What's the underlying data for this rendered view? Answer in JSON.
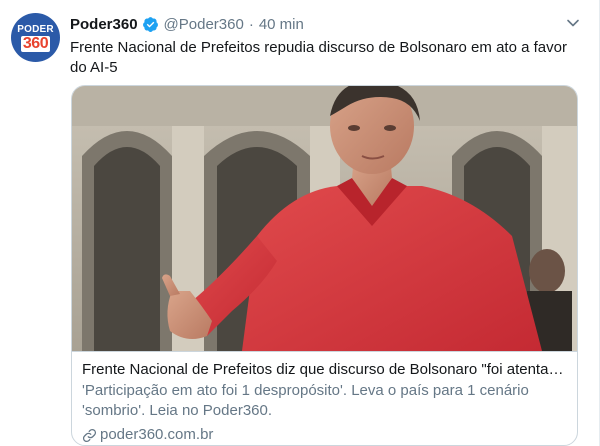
{
  "author": {
    "display_name": "Poder360",
    "handle": "@Poder360",
    "separator": "·",
    "time": "40 min",
    "avatar_icon": "poder360-logo",
    "avatar_text_top": "PODER",
    "avatar_text_bottom": "360",
    "verified_icon": "verified-badge-icon",
    "verified_color": "#1da1f2"
  },
  "tweet": {
    "text": "Frente Nacional de Prefeitos repudia discurso de Bolsonaro em ato a favor do AI-5"
  },
  "card": {
    "title": "Frente Nacional de Prefeitos diz que discurso de Bolsonaro \"foi atentad...",
    "description": "'Participação em ato foi 1 despropósito'. Leva o país para 1 cenário 'sombrio'. Leia no Poder360.",
    "domain": "poder360.com.br",
    "link_icon": "link-icon"
  },
  "colors": {
    "text_primary": "#14171a",
    "text_secondary": "#657786",
    "border": "#ccd6dd",
    "accent": "#1da1f2",
    "shirt_red": "#d8333a"
  }
}
